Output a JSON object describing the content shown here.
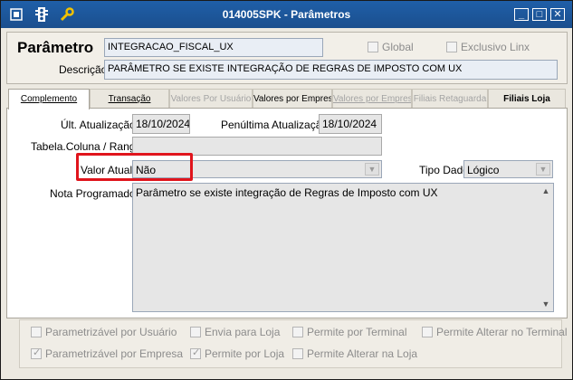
{
  "window": {
    "title": "014005SPK - Parâmetros",
    "minimize": "_",
    "maximize": "□",
    "close": "✕"
  },
  "header": {
    "parametro_label": "Parâmetro",
    "parametro_value": "INTEGRACAO_FISCAL_UX",
    "descricao_label": "Descrição",
    "descricao_value": "PARÂMETRO SE EXISTE INTEGRAÇÃO DE REGRAS DE IMPOSTO COM UX",
    "global_label": "Global",
    "exclusivo_label": "Exclusivo Linx"
  },
  "tabs": [
    {
      "label": "Complemento"
    },
    {
      "label": "Transação"
    },
    {
      "label": "Valores Por Usuário"
    },
    {
      "label": "Valores por Empresa"
    },
    {
      "label": "Valores por Empresa"
    },
    {
      "label": "Filiais Retaguarda"
    },
    {
      "label": "Filiais Loja"
    }
  ],
  "form": {
    "ult_atualizacao_label": "Últ. Atualização",
    "ult_atualizacao_value": "18/10/2024",
    "penultima_label": "Penúltima Atualização",
    "penultima_value": "18/10/2024",
    "tabela_label": "Tabela.Coluna / Range",
    "tabela_value": "",
    "valor_atual_label": "Valor Atual",
    "valor_atual_value": "Não",
    "tipo_dado_label": "Tipo Dado",
    "tipo_dado_value": "Lógico",
    "nota_label": "Nota Programador",
    "nota_value": "Parâmetro se existe integração de Regras de Imposto com UX"
  },
  "checkboxes": {
    "parametrizavel_usuario": "Parametrizável por Usuário",
    "envia_loja": "Envia para Loja",
    "permite_terminal": "Permite por Terminal",
    "permite_alterar_terminal": "Permite Alterar no Terminal",
    "parametrizavel_empresa": "Parametrizável por Empresa",
    "permite_loja": "Permite por Loja",
    "permite_alterar_loja": "Permite Alterar na Loja"
  },
  "colors": {
    "titlebar": "#1f5fa8",
    "highlight": "#e0141c"
  }
}
